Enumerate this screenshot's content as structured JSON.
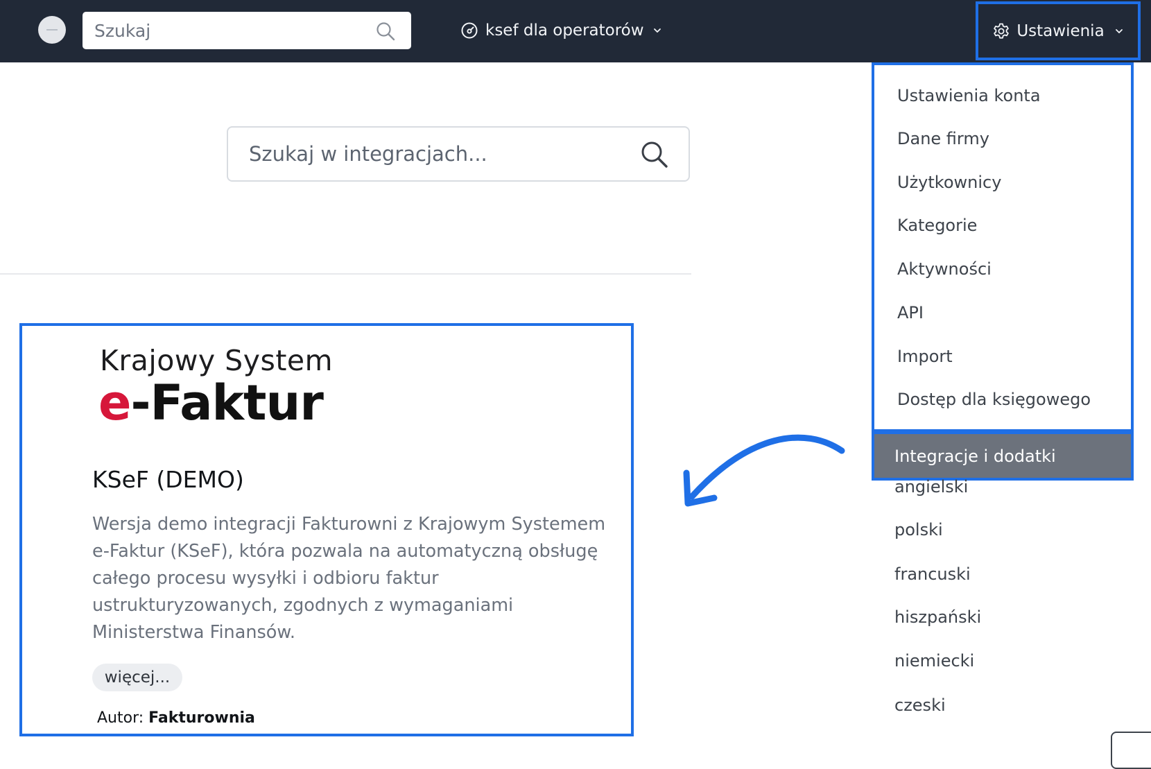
{
  "topbar": {
    "search_placeholder": "Szukaj",
    "company_label": "ksef dla operatorów",
    "settings_label": "Ustawienia"
  },
  "main": {
    "search_placeholder": "Szukaj w integracjach..."
  },
  "card": {
    "logo_line1": "Krajowy System",
    "logo_e": "e",
    "logo_rest": "-Faktur",
    "title": "KSeF (DEMO)",
    "description": "Wersja demo integracji Fakturowni z Krajowym Systemem e-Faktur (KSeF), która pozwala na automatyczną obsługę całego procesu wysyłki i odbioru faktur ustrukturyzowanych, zgodnych z wymaganiami Ministerstwa Finansów.",
    "more_label": "więcej...",
    "author_label": "Autor:",
    "author_name": "Fakturownia"
  },
  "settings_menu": {
    "items": [
      {
        "label": "Ustawienia konta"
      },
      {
        "label": "Dane firmy"
      },
      {
        "label": "Użytkownicy"
      },
      {
        "label": "Kategorie"
      },
      {
        "label": "Aktywności"
      },
      {
        "label": "API"
      },
      {
        "label": "Import"
      },
      {
        "label": "Dostęp dla księgowego"
      }
    ],
    "active_item": "Integracje i dodatki",
    "languages": [
      {
        "label": "angielski"
      },
      {
        "label": "polski"
      },
      {
        "label": "francuski"
      },
      {
        "label": "hiszpański"
      },
      {
        "label": "niemiecki"
      },
      {
        "label": "czeski"
      }
    ]
  },
  "colors": {
    "topbar_bg": "#212937",
    "highlight_border": "#1f6fe6",
    "active_menu_bg": "#6c727c",
    "logo_accent": "#d6173a"
  },
  "icons": {
    "top_search": "search-icon",
    "company": "gauge-icon",
    "settings": "gear-icon",
    "chevron": "chevron-down-icon",
    "main_search": "search-icon",
    "annotation": "curved-arrow-icon"
  }
}
